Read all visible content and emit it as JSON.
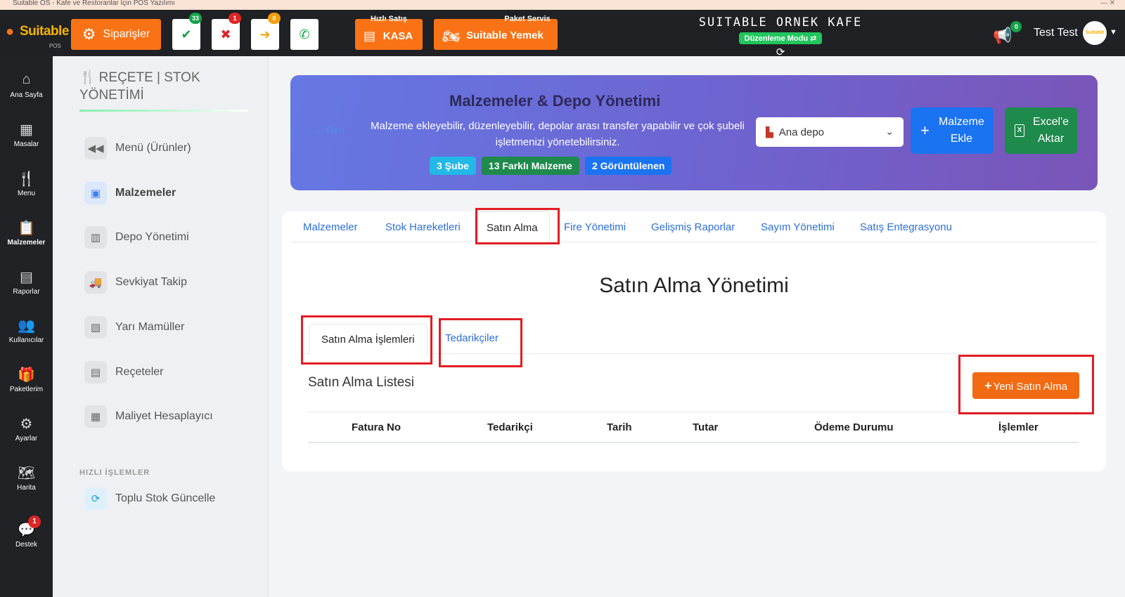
{
  "window": {
    "title": "Suitable OS - Kafe ve Restoranlar İçin POS Yazılımı",
    "controls": "—  ✕"
  },
  "topbar": {
    "logo_text": "Suitable",
    "logo_sub": "POS",
    "orders_label": "Siparişler",
    "quick_buttons": [
      {
        "icon": "✔",
        "badge": "33",
        "badge_color": "#16a34a",
        "icon_color": "#16a34a"
      },
      {
        "icon": "✖",
        "badge": "1",
        "badge_color": "#dc2626",
        "icon_color": "#dc2626"
      },
      {
        "icon": "➔",
        "badge": "0",
        "badge_color": "#f59e0b",
        "icon_color": "#f59e0b"
      },
      {
        "icon": "✆",
        "badge": "",
        "badge_color": "",
        "icon_color": "#16a34a"
      }
    ],
    "kasa_caption": "Hızlı Satış",
    "kasa_label": "KASA",
    "paket_caption": "Paket Servis",
    "paket_label": "Suitable Yemek",
    "cafe_name": "SUITABLE ORNEK KAFE",
    "mode_label": "Düzenleme Modu ⇄",
    "notify_count": "0",
    "user_name": "Test Test",
    "avatar_text": "Suitable"
  },
  "rail": [
    {
      "icon": "⌂",
      "label": "Ana Sayfa",
      "name": "home"
    },
    {
      "icon": "▦",
      "label": "Masalar",
      "name": "tables"
    },
    {
      "icon": "🍴",
      "label": "Menu",
      "name": "menu"
    },
    {
      "icon": "📋",
      "label": "Malzemeler",
      "name": "materials",
      "active": true
    },
    {
      "icon": "▤",
      "label": "Raporlar",
      "name": "reports"
    },
    {
      "icon": "👥",
      "label": "Kullanıcılar",
      "name": "users"
    },
    {
      "icon": "🎁",
      "label": "Paketlerim",
      "name": "packages"
    },
    {
      "icon": "⚙",
      "label": "Ayarlar",
      "name": "settings"
    },
    {
      "icon": "🗺",
      "label": "Harita",
      "name": "map"
    },
    {
      "icon": "💬",
      "label": "Destek",
      "name": "support",
      "badge": "1"
    }
  ],
  "sidebar": {
    "title": "REÇETE | STOK YÖNETİMİ",
    "items": [
      {
        "icon": "◀◀",
        "label": "Menü (Ürünler)",
        "name": "menu-products"
      },
      {
        "icon": "▣",
        "label": "Malzemeler",
        "name": "materials",
        "active": true
      },
      {
        "icon": "▥",
        "label": "Depo Yönetimi",
        "name": "warehouse"
      },
      {
        "icon": "🚚",
        "label": "Sevkiyat Takip",
        "name": "shipment"
      },
      {
        "icon": "▧",
        "label": "Yarı Mamüller",
        "name": "semi-products"
      },
      {
        "icon": "▤",
        "label": "Reçeteler",
        "name": "recipes"
      },
      {
        "icon": "▦",
        "label": "Maliyet Hesaplayıcı",
        "name": "cost-calculator"
      }
    ],
    "quick_section": "HIZLI İŞLEMLER",
    "quick_items": [
      {
        "icon": "⟳",
        "label": "Toplu Stok Güncelle",
        "name": "bulk-stock-update"
      }
    ]
  },
  "hero": {
    "back": "← Geri",
    "title": "Malzemeler & Depo Yönetimi",
    "description": "Malzeme ekleyebilir, düzenleyebilir, depolar arası transfer yapabilir ve çok şubeli işletmenizi yönetebilirsiniz.",
    "chips": [
      {
        "text": "3 Şube",
        "color": "#22b8e8"
      },
      {
        "text": "13 Farklı Malzeme",
        "color": "#1e8a4c"
      },
      {
        "text": "2 Görüntülenen",
        "color": "#1a73f0"
      }
    ],
    "depot_selected": "Ana depo",
    "add_label": "Malzeme Ekle",
    "excel_label": "Excel'e Aktar"
  },
  "tabs": [
    {
      "label": "Malzemeler"
    },
    {
      "label": "Stok Hareketleri"
    },
    {
      "label": "Satın Alma",
      "active": true
    },
    {
      "label": "Fire Yönetimi"
    },
    {
      "label": "Gelişmiş Raporlar"
    },
    {
      "label": "Sayım Yönetimi"
    },
    {
      "label": "Satış Entegrasyonu"
    }
  ],
  "purchase": {
    "title": "Satın Alma Yönetimi",
    "subtabs": [
      {
        "label": "Satın Alma İşlemleri",
        "active": true
      },
      {
        "label": "Tedarikçiler"
      }
    ],
    "list_title": "Satın Alma Listesi",
    "new_button": "Yeni Satın Alma",
    "columns": [
      "Fatura No",
      "Tedarikçi",
      "Tarih",
      "Tutar",
      "Ödeme Durumu",
      "İşlemler"
    ]
  }
}
